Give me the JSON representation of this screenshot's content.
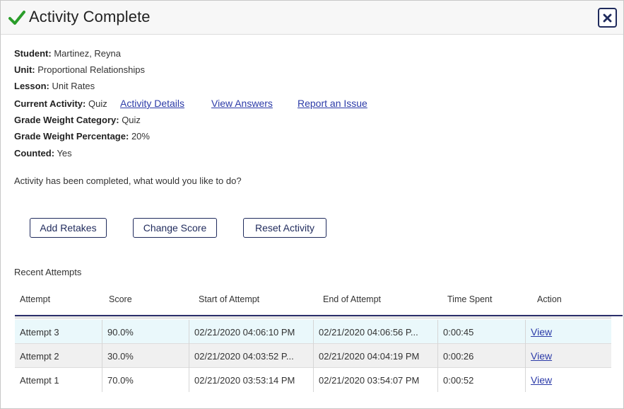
{
  "dialog": {
    "title": "Activity Complete"
  },
  "info": {
    "student_label": "Student:",
    "student_value": "Martinez, Reyna",
    "unit_label": "Unit:",
    "unit_value": "Proportional Relationships",
    "lesson_label": "Lesson:",
    "lesson_value": "Unit Rates",
    "activity_label": "Current Activity:",
    "activity_value": "Quiz",
    "activity_details_link": "Activity Details",
    "view_answers_link": "View Answers",
    "report_issue_link": "Report an Issue",
    "weight_category_label": "Grade Weight Category:",
    "weight_category_value": "Quiz",
    "weight_percentage_label": "Grade Weight Percentage:",
    "weight_percentage_value": "20%",
    "counted_label": "Counted:",
    "counted_value": "Yes"
  },
  "prompt": "Activity has been completed, what would you like to do?",
  "actions": {
    "add_retakes": "Add Retakes",
    "change_score": "Change Score",
    "reset_activity": "Reset Activity"
  },
  "attempts": {
    "title": "Recent Attempts",
    "columns": [
      "Attempt",
      "Score",
      "Start of Attempt",
      "End of Attempt",
      "Time Spent",
      "Action"
    ],
    "rows": [
      {
        "attempt": "Attempt 3",
        "score": "90.0%",
        "start": "02/21/2020 04:06:10 PM",
        "end": "02/21/2020 04:06:56 P...",
        "time": "0:00:45",
        "action": "View"
      },
      {
        "attempt": "Attempt 2",
        "score": "30.0%",
        "start": "02/21/2020 04:03:52 P...",
        "end": "02/21/2020 04:04:19 PM",
        "time": "0:00:26",
        "action": "View"
      },
      {
        "attempt": "Attempt 1",
        "score": "70.0%",
        "start": "02/21/2020 03:53:14 PM",
        "end": "02/21/2020 03:54:07 PM",
        "time": "0:00:52",
        "action": "View"
      }
    ]
  },
  "colors": {
    "check": "#2a9d2a",
    "navy": "#1f2a5c",
    "link": "#2c3ba8",
    "row_highlight": "#eaf8fb",
    "row_alt": "#f0f0f0"
  }
}
